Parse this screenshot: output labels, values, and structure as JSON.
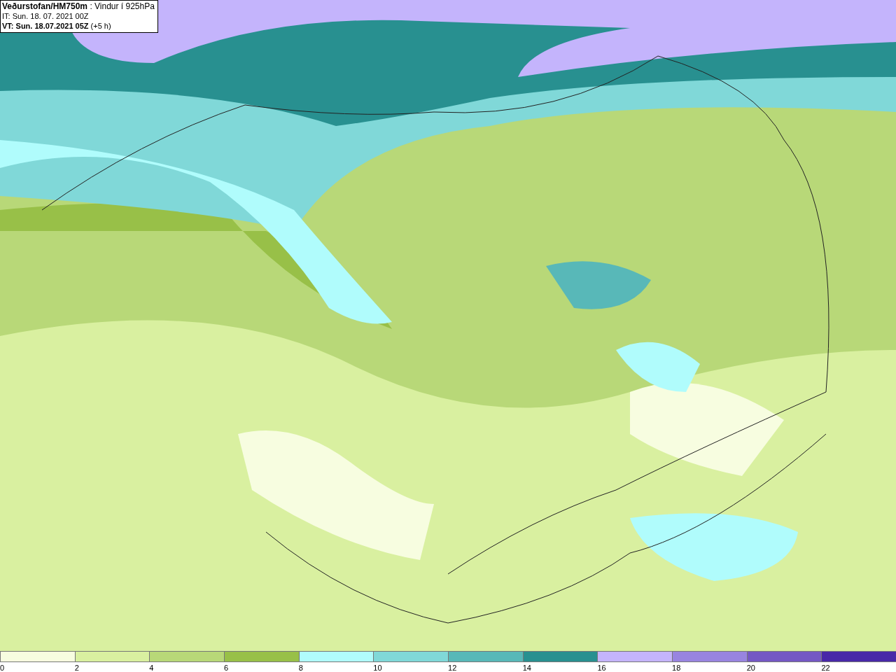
{
  "header": {
    "title": "**Veðurstofan/HM750m** : Vindur í 925hPa",
    "init_time": "IT: Sun. 18. 07. 2021 00Z",
    "valid_time": "**VT: Sun. 18.07.2021 05Z** (+5 h)"
  },
  "legend": [
    {
      "label": "0",
      "color": "#f7fde0"
    },
    {
      "label": "2",
      "color": "#d9f0a0"
    },
    {
      "label": "4",
      "color": "#b8d878"
    },
    {
      "label": "6",
      "color": "#98c048"
    },
    {
      "label": "8",
      "color": "#b0fcfc"
    },
    {
      "label": "10",
      "color": "#80d8d8"
    },
    {
      "label": "12",
      "color": "#58b8b8"
    },
    {
      "label": "14",
      "color": "#289090"
    },
    {
      "label": "16",
      "color": "#c4b4fc"
    },
    {
      "label": "18",
      "color": "#9884e0"
    },
    {
      "label": "20",
      "color": "#7458c4"
    },
    {
      "label": "22",
      "color": "#4828a8"
    }
  ]
}
